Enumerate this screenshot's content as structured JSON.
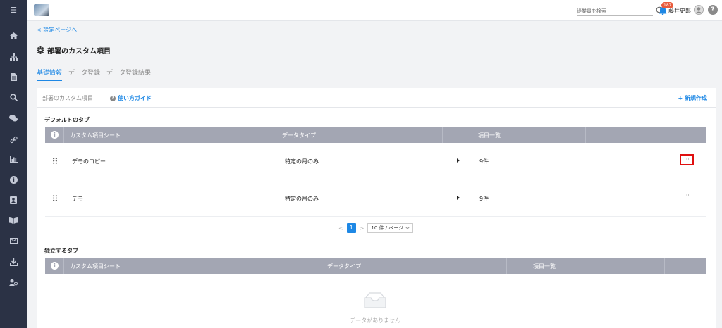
{
  "sidebar": {
    "items": [
      {
        "name": "menu-icon",
        "glyph": "☰"
      },
      {
        "name": "home-icon",
        "glyph": "⌂"
      },
      {
        "name": "org-chart-icon",
        "glyph": "♣"
      },
      {
        "name": "document-icon",
        "glyph": "▤"
      },
      {
        "name": "search-icon",
        "glyph": "⚲"
      },
      {
        "name": "chat-icon",
        "glyph": "●"
      },
      {
        "name": "link-icon",
        "glyph": "∞"
      },
      {
        "name": "bar-chart-icon",
        "glyph": "▥"
      },
      {
        "name": "info-icon",
        "glyph": "ℹ"
      },
      {
        "name": "contact-card-icon",
        "glyph": "▣"
      },
      {
        "name": "book-icon",
        "glyph": "◫"
      },
      {
        "name": "mail-icon",
        "glyph": "✉"
      },
      {
        "name": "download-icon",
        "glyph": "⤓"
      },
      {
        "name": "user-settings-icon",
        "glyph": "⚙"
      }
    ]
  },
  "header": {
    "search_placeholder": "従業員を検索",
    "notification_count": "187",
    "username": "藤井史郎",
    "help_label": "?"
  },
  "nav": {
    "back_link": "< 設定ページへ"
  },
  "page": {
    "title": "部署のカスタム項目",
    "tabs": [
      {
        "label": "基礎情報",
        "active": true
      },
      {
        "label": "データ登録",
        "active": false
      },
      {
        "label": "データ登録結果",
        "active": false
      }
    ]
  },
  "card": {
    "title": "部署のカスタム項目",
    "guide_label": "使い方ガイド",
    "new_label": "+ 新規作成"
  },
  "default_tabs": {
    "section_title": "デフォルトのタブ",
    "columns": [
      "カスタム項目シート",
      "データタイプ",
      "項目一覧"
    ],
    "rows": [
      {
        "name": "デモのコピー",
        "type": "特定の月のみ",
        "count": "9件",
        "more": "···"
      },
      {
        "name": "デモ",
        "type": "特定の月のみ",
        "count": "9件",
        "more": "···"
      }
    ],
    "pagination": {
      "prev": "<",
      "current": "1",
      "next": ">",
      "page_size": "10 件 / ページ"
    }
  },
  "independent_tabs": {
    "section_title": "独立するタブ",
    "columns": [
      "カスタム項目シート",
      "データタイプ",
      "項目一覧"
    ],
    "empty_text": "データがありません"
  },
  "colors": {
    "sidebar_bg": "#2b3245",
    "accent": "#1e88e5",
    "table_header": "#a3a6b3",
    "badge": "#e95b3c",
    "highlight_border": "#e01010"
  }
}
